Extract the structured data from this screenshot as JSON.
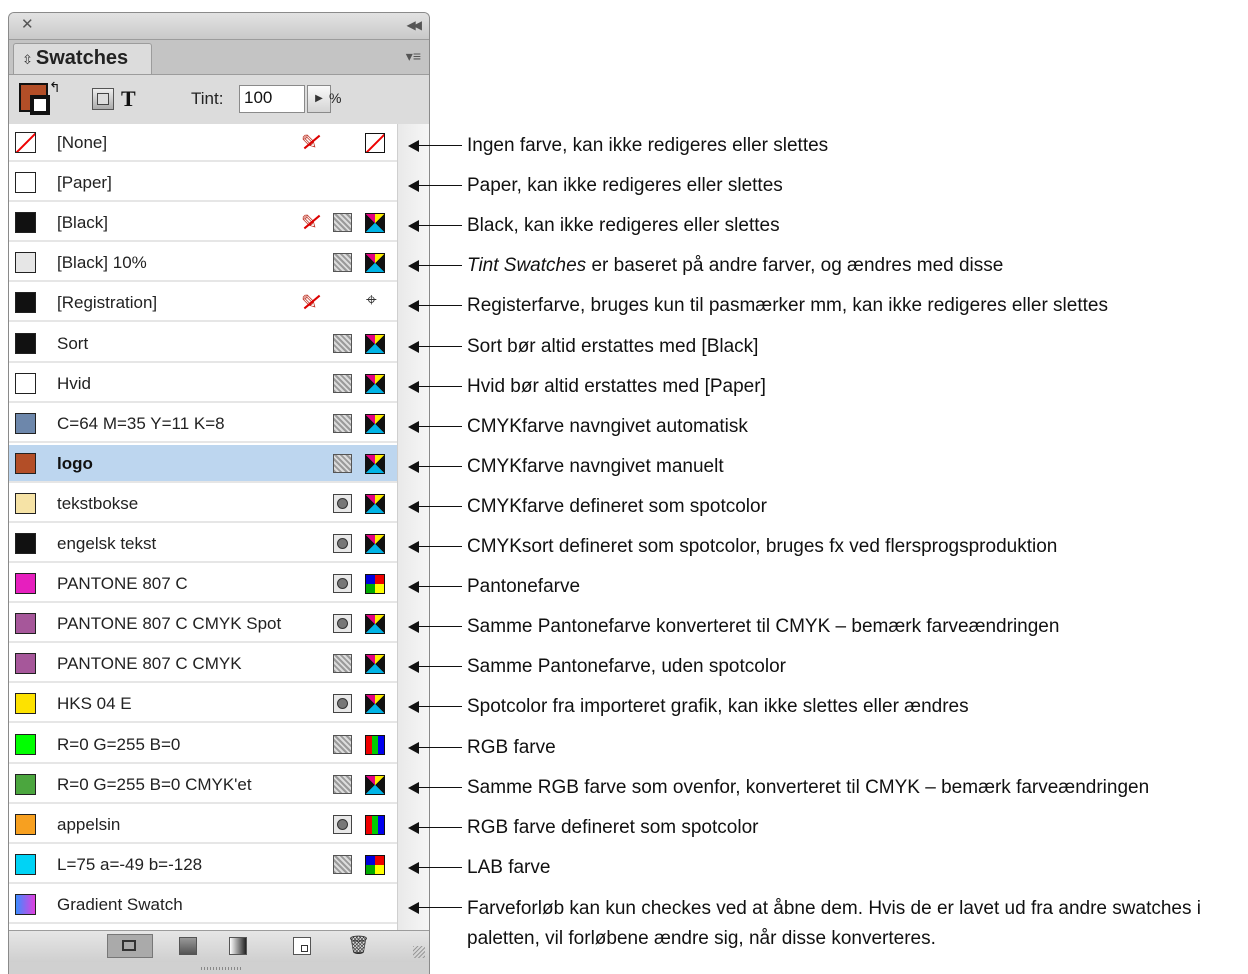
{
  "panel": {
    "tab_title": "Swatches",
    "tint_label": "Tint:",
    "tint_value": "100",
    "percent": "%"
  },
  "swatches": [
    {
      "name": "[None]",
      "color": "none",
      "icons": [
        "no-edit",
        "none"
      ]
    },
    {
      "name": "[Paper]",
      "color": "#ffffff",
      "icons": []
    },
    {
      "name": "[Black]",
      "color": "#111111",
      "icons": [
        "no-edit",
        "process",
        "cmyk"
      ]
    },
    {
      "name": "[Black] 10%",
      "color": "#e6e6e6",
      "icons": [
        "process",
        "cmyk"
      ]
    },
    {
      "name": "[Registration]",
      "color": "#111111",
      "icons": [
        "no-edit",
        "registration"
      ]
    },
    {
      "name": "Sort",
      "color": "#111111",
      "icons": [
        "process",
        "cmyk"
      ]
    },
    {
      "name": "Hvid",
      "color": "#ffffff",
      "icons": [
        "process",
        "cmyk"
      ]
    },
    {
      "name": "C=64 M=35 Y=11 K=8",
      "color": "#6d87ab",
      "icons": [
        "process",
        "cmyk"
      ]
    },
    {
      "name": "logo",
      "color": "#b34e27",
      "icons": [
        "process",
        "cmyk"
      ],
      "selected": true
    },
    {
      "name": "tekstbokse",
      "color": "#f6e3a6",
      "icons": [
        "spot",
        "cmyk"
      ]
    },
    {
      "name": "engelsk tekst",
      "color": "#111111",
      "icons": [
        "spot",
        "cmyk"
      ]
    },
    {
      "name": "PANTONE 807 C",
      "color": "#e61fbe",
      "icons": [
        "spot",
        "lab"
      ]
    },
    {
      "name": "PANTONE 807 C CMYK Spot",
      "color": "#a6579a",
      "icons": [
        "spot",
        "cmyk"
      ]
    },
    {
      "name": "PANTONE 807 C CMYK",
      "color": "#a6579a",
      "icons": [
        "process",
        "cmyk"
      ]
    },
    {
      "name": "HKS 04 E",
      "color": "#fde200",
      "icons": [
        "spot",
        "cmyk"
      ]
    },
    {
      "name": "R=0 G=255 B=0",
      "color": "#00ff00",
      "icons": [
        "process",
        "rgb"
      ]
    },
    {
      "name": "R=0 G=255 B=0 CMYK'et",
      "color": "#4ba63e",
      "icons": [
        "process",
        "cmyk"
      ]
    },
    {
      "name": "appelsin",
      "color": "#f7a020",
      "icons": [
        "spot",
        "rgb"
      ]
    },
    {
      "name": "L=75 a=-49 b=-128",
      "color": "#00d3f5",
      "icons": [
        "process",
        "lab"
      ]
    },
    {
      "name": "Gradient Swatch",
      "color": "gradient",
      "icons": []
    }
  ],
  "annotations": [
    "Ingen farve, kan ikke redigeres eller slettes",
    "Paper, kan ikke redigeres eller slettes",
    "Black, kan ikke redigeres eller slettes",
    "er baseret på andre farver, og ændres med disse",
    "Registerfarve, bruges kun til pasmærker mm, kan ikke redigeres eller slettes",
    "Sort bør altid erstattes med [Black]",
    "Hvid bør altid erstattes med [Paper]",
    "CMYKfarve navngivet automatisk",
    "CMYKfarve navngivet manuelt",
    "CMYKfarve defineret som spotcolor",
    "CMYKsort defineret som spotcolor, bruges fx ved flersprogsproduktion",
    "Pantonefarve",
    "Samme Pantonefarve konverteret til CMYK – bemærk farveændringen",
    "Samme Pantonefarve, uden spotcolor",
    "Spotcolor fra importeret grafik, kan ikke slettes eller ændres",
    "RGB farve",
    "Samme RGB farve som ovenfor, konverteret til CMYK – bemærk farveændringen",
    "RGB farve defineret som spotcolor",
    "LAB farve",
    "Farveforløb kan kun checkes ved at åbne dem. Hvis de er lavet ud fra andre swatches i paletten, vil forløbene ændre sig, når disse konverteres."
  ],
  "annotation_emphasis": "Tint Swatches"
}
